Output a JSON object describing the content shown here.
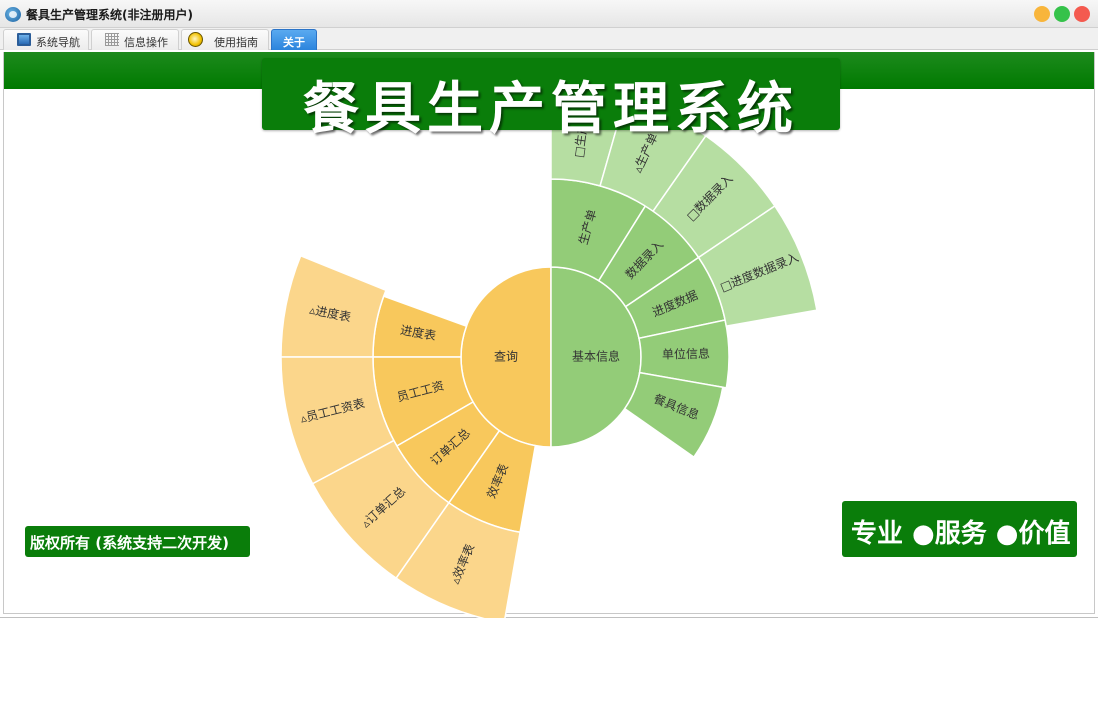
{
  "window": {
    "title": "餐具生产管理系统(非注册用户)",
    "controls": {
      "minimize_color": "#f8b53b",
      "maximize_color": "#35c24a",
      "close_color": "#f45a4f"
    }
  },
  "tabs": [
    {
      "label": "系统导航",
      "icon": "monitor-icon"
    },
    {
      "label": "信息操作",
      "icon": "grid-icon"
    },
    {
      "label": "使用指南",
      "icon": "lightbulb-icon"
    },
    {
      "label": "关于",
      "icon": "",
      "active": true
    }
  ],
  "banner": {
    "title": "餐具生产管理系统",
    "accent_color": "#0a7d0a"
  },
  "footer": {
    "copyright": "版权所有 (系统支持二次开发)",
    "slogan": "专业 ●服务 ●价值"
  },
  "sunburst": {
    "colors": {
      "query_inner": "#f8c85c",
      "query_outer": "#fbd68b",
      "basic_inner": "#93cc78",
      "basic_outer": "#b6dea2"
    },
    "center": [
      {
        "label": "查询"
      },
      {
        "label": "基本信息"
      }
    ],
    "ring1": [
      {
        "label": "进度表"
      },
      {
        "label": "员工工资"
      },
      {
        "label": "订单汇总"
      },
      {
        "label": "效率表"
      },
      {
        "label": "生产单"
      },
      {
        "label": "数据录入"
      },
      {
        "label": "进度数据"
      },
      {
        "label": "单位信息"
      },
      {
        "label": "餐具信息"
      }
    ],
    "ring2": [
      {
        "label": "▵进度表"
      },
      {
        "label": "▵员工工资表"
      },
      {
        "label": "▵订单汇总"
      },
      {
        "label": "▵效率表"
      },
      {
        "label": "□生产单"
      },
      {
        "label": "▵生产单"
      },
      {
        "label": "□数据录入"
      },
      {
        "label": "□进度数据录入"
      }
    ]
  }
}
